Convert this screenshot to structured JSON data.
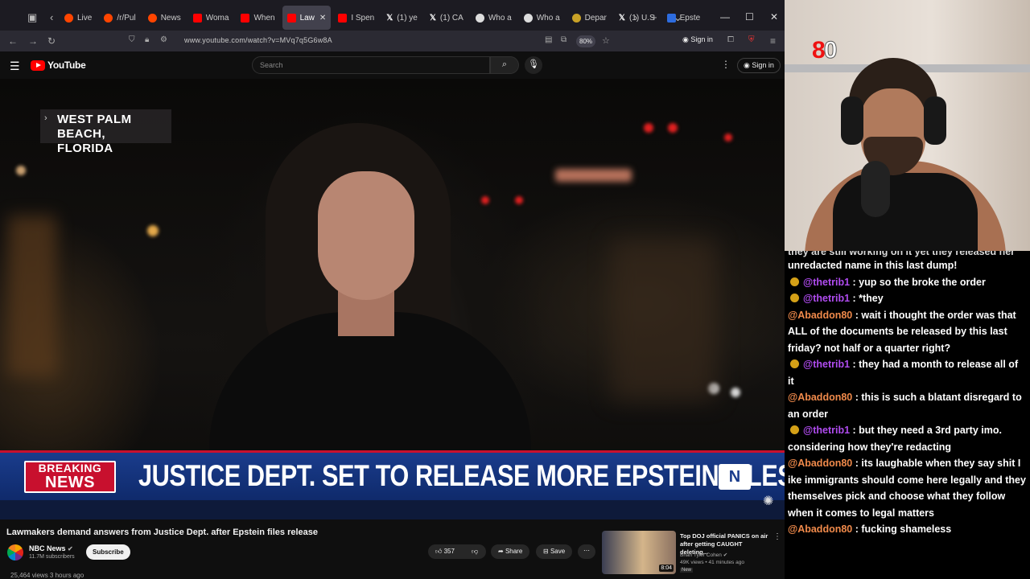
{
  "browser": {
    "tabs": [
      {
        "label": "Live",
        "icon": "rd"
      },
      {
        "label": "/r/Pul",
        "icon": "rd"
      },
      {
        "label": "News",
        "icon": "rd"
      },
      {
        "label": "Woma",
        "icon": "yt"
      },
      {
        "label": "When",
        "icon": "yt"
      },
      {
        "label": "Law",
        "icon": "yt",
        "active": true
      },
      {
        "label": "I Spen",
        "icon": "yt"
      },
      {
        "label": "(1) ye",
        "icon": "x"
      },
      {
        "label": "(1) CA",
        "icon": "x"
      },
      {
        "label": "Who a",
        "icon": "gh"
      },
      {
        "label": "Who a",
        "icon": "gh"
      },
      {
        "label": "Depar",
        "icon": "doj"
      },
      {
        "label": "(1) U.S",
        "icon": "x"
      },
      {
        "label": "Epste",
        "icon": "ep"
      }
    ],
    "url": "www.youtube.com/watch?v=MVq7q5G6w8A",
    "zoom": "80%",
    "sign_in": "Sign in"
  },
  "youtube": {
    "logo": "YouTube",
    "search_placeholder": "Search",
    "sign_in": "Sign in"
  },
  "video": {
    "location": "WEST PALM BEACH, FLORIDA",
    "location_line1": "WEST PALM BEACH,",
    "location_line2": "FLORIDA",
    "breaking_line1": "BREAKING",
    "breaking_line2": "NEWS",
    "headline": "JUSTICE DEPT. SET TO RELEASE MORE EPSTEIN FILES",
    "network_logo": "N"
  },
  "info": {
    "title": "Lawmakers demand answers from Justice Dept. after Epstein files release",
    "channel": "NBC News",
    "subscribers": "11.7M subscribers",
    "subscribe": "Subscribe",
    "likes": "357",
    "share": "Share",
    "save": "Save",
    "views": "25,464 views  3 hours ago"
  },
  "recommendation": {
    "title": "Top DOJ official PANICS on air after getting CAUGHT deleting...",
    "channel": "Brian Tyler Cohen",
    "meta": "49K views • 41 minutes ago",
    "badge": "New",
    "duration": "8:04"
  },
  "overlay": {
    "logo_red": "8",
    "logo_white": "0"
  },
  "chat": {
    "partial_top": "they are still working on it yet they released her",
    "messages": [
      {
        "user": "",
        "text": "unredacted name in this last dump!",
        "badge": false,
        "color": "none"
      },
      {
        "user": "@thetrib1",
        "text": " : yup so the broke the order",
        "badge": true,
        "color": "purple"
      },
      {
        "user": "@thetrib1",
        "text": " : *they",
        "badge": true,
        "color": "purple"
      },
      {
        "user": "@Abaddon80",
        "text": " : wait i thought the order was that ALL of the documents be released by this last friday? not half or a quarter right?",
        "badge": false,
        "color": "orange"
      },
      {
        "user": "@thetrib1",
        "text": " : they had a month to release all of it",
        "badge": true,
        "color": "purple"
      },
      {
        "user": "@Abaddon80",
        "text": " : this is such a blatant disregard to an order",
        "badge": false,
        "color": "orange"
      },
      {
        "user": "@thetrib1",
        "text": " : but they need a 3rd party imo. considering how they're redacting",
        "badge": true,
        "color": "purple"
      },
      {
        "user": "@Abaddon80",
        "text": " : its laughable when they say shit I ike immigrants should come here legally and they themselves pick and choose what they follow when it comes to legal matters",
        "badge": false,
        "color": "orange"
      },
      {
        "user": "@Abaddon80",
        "text": " : fucking shameless",
        "badge": false,
        "color": "orange"
      }
    ]
  },
  "colors": {
    "breaking_red": "#c8102e",
    "banner_blue": "#1a3c8c",
    "chat_purple": "#b04cf0",
    "chat_orange": "#f08a4b"
  }
}
